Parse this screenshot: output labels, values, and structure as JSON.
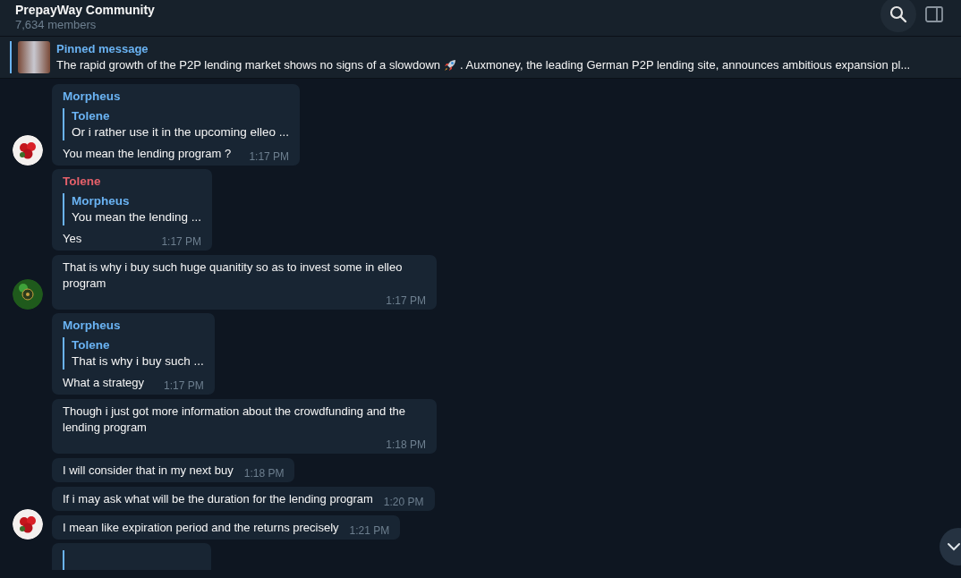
{
  "header": {
    "title": "PrepayWay Community",
    "subtitle": "7,634 members"
  },
  "pinned": {
    "label": "Pinned message",
    "text_before": "The rapid growth of the P2P lending market shows no signs of a slowdown",
    "text_after": ". Auxmoney, the leading German P2P lending site, announces ambitious expansion pl..."
  },
  "groups": [
    {
      "avatar": {
        "kind": "flowers"
      },
      "messages": [
        {
          "sender": "Morpheus",
          "color": "#6ab3f3",
          "reply": {
            "name": "Tolene",
            "text": "Or i rather use it in the upcoming elleo ..."
          },
          "text": "You mean the lending program ?",
          "time": "1:17 PM"
        }
      ]
    },
    {
      "avatar": {
        "kind": "coin"
      },
      "messages": [
        {
          "sender": "Tolene",
          "color": "#e5606a",
          "reply": {
            "name": "Morpheus",
            "text": "You mean the lending ..."
          },
          "text": "Yes",
          "time": "1:17 PM"
        },
        {
          "text": "That is why i buy such huge quanitity so as to invest some in elleo program",
          "time": "1:17 PM"
        }
      ]
    },
    {
      "avatar": {
        "kind": "flowers"
      },
      "messages": [
        {
          "sender": "Morpheus",
          "color": "#6ab3f3",
          "reply": {
            "name": "Tolene",
            "text": "That is why i buy such ..."
          },
          "text": "What a strategy",
          "time": "1:17 PM"
        },
        {
          "text": "Though i just got more information about the crowdfunding and the lending program",
          "time": "1:18 PM"
        },
        {
          "text": "I will consider that in my next buy",
          "time": "1:18 PM"
        },
        {
          "text": "If i may ask what will be the duration for the lending program",
          "time": "1:20 PM"
        },
        {
          "text": "I mean like expiration period and the returns precisely",
          "time": "1:21 PM"
        }
      ]
    }
  ]
}
